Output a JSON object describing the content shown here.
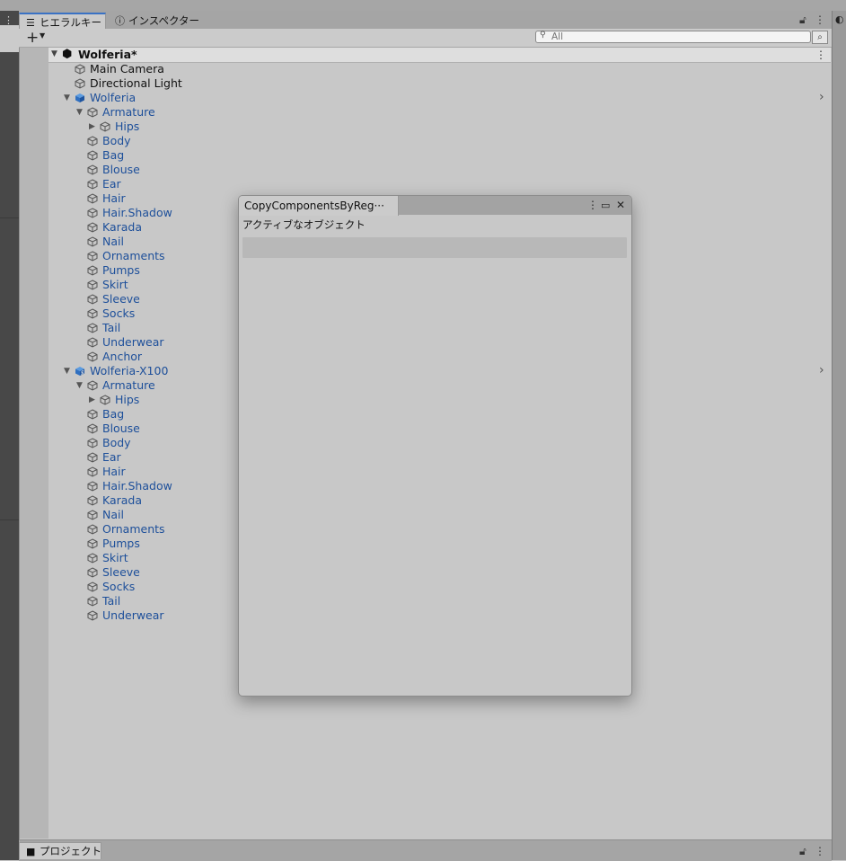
{
  "hierarchy_tab": {
    "label": "ヒエラルキー",
    "icon": "list-icon"
  },
  "inspector_tab": {
    "label": "インスペクター",
    "icon": "info-icon"
  },
  "toolbar": {
    "add_label": "+",
    "search_placeholder": "All"
  },
  "scene": {
    "name": "Wolferia*"
  },
  "tree": [
    {
      "label": "Main Camera",
      "depth": 1,
      "color": "black",
      "expand": "none"
    },
    {
      "label": "Directional Light",
      "depth": 1,
      "color": "black",
      "expand": "none"
    },
    {
      "label": "Wolferia",
      "depth": 1,
      "color": "blue",
      "expand": "open",
      "prefab": true
    },
    {
      "label": "Armature",
      "depth": 2,
      "color": "blue",
      "expand": "open"
    },
    {
      "label": "Hips",
      "depth": 3,
      "color": "blue",
      "expand": "closed"
    },
    {
      "label": "Body",
      "depth": 2,
      "color": "blue",
      "expand": "none"
    },
    {
      "label": "Bag",
      "depth": 2,
      "color": "blue",
      "expand": "none"
    },
    {
      "label": "Blouse",
      "depth": 2,
      "color": "blue",
      "expand": "none"
    },
    {
      "label": "Ear",
      "depth": 2,
      "color": "blue",
      "expand": "none"
    },
    {
      "label": "Hair",
      "depth": 2,
      "color": "blue",
      "expand": "none"
    },
    {
      "label": "Hair.Shadow",
      "depth": 2,
      "color": "blue",
      "expand": "none"
    },
    {
      "label": "Karada",
      "depth": 2,
      "color": "blue",
      "expand": "none"
    },
    {
      "label": "Nail",
      "depth": 2,
      "color": "blue",
      "expand": "none"
    },
    {
      "label": "Ornaments",
      "depth": 2,
      "color": "blue",
      "expand": "none"
    },
    {
      "label": "Pumps",
      "depth": 2,
      "color": "blue",
      "expand": "none"
    },
    {
      "label": "Skirt",
      "depth": 2,
      "color": "blue",
      "expand": "none"
    },
    {
      "label": "Sleeve",
      "depth": 2,
      "color": "blue",
      "expand": "none"
    },
    {
      "label": "Socks",
      "depth": 2,
      "color": "blue",
      "expand": "none"
    },
    {
      "label": "Tail",
      "depth": 2,
      "color": "blue",
      "expand": "none"
    },
    {
      "label": "Underwear",
      "depth": 2,
      "color": "blue",
      "expand": "none"
    },
    {
      "label": "Anchor",
      "depth": 2,
      "color": "blue",
      "expand": "none"
    },
    {
      "label": "Wolferia-X100",
      "depth": 1,
      "color": "blue",
      "expand": "open",
      "prefab": true,
      "variant": true
    },
    {
      "label": "Armature",
      "depth": 2,
      "color": "blue",
      "expand": "open"
    },
    {
      "label": "Hips",
      "depth": 3,
      "color": "blue",
      "expand": "closed"
    },
    {
      "label": "Bag",
      "depth": 2,
      "color": "blue",
      "expand": "none"
    },
    {
      "label": "Blouse",
      "depth": 2,
      "color": "blue",
      "expand": "none"
    },
    {
      "label": "Body",
      "depth": 2,
      "color": "blue",
      "expand": "none"
    },
    {
      "label": "Ear",
      "depth": 2,
      "color": "blue",
      "expand": "none"
    },
    {
      "label": "Hair",
      "depth": 2,
      "color": "blue",
      "expand": "none"
    },
    {
      "label": "Hair.Shadow",
      "depth": 2,
      "color": "blue",
      "expand": "none"
    },
    {
      "label": "Karada",
      "depth": 2,
      "color": "blue",
      "expand": "none"
    },
    {
      "label": "Nail",
      "depth": 2,
      "color": "blue",
      "expand": "none"
    },
    {
      "label": "Ornaments",
      "depth": 2,
      "color": "blue",
      "expand": "none"
    },
    {
      "label": "Pumps",
      "depth": 2,
      "color": "blue",
      "expand": "none"
    },
    {
      "label": "Skirt",
      "depth": 2,
      "color": "blue",
      "expand": "none"
    },
    {
      "label": "Sleeve",
      "depth": 2,
      "color": "blue",
      "expand": "none"
    },
    {
      "label": "Socks",
      "depth": 2,
      "color": "blue",
      "expand": "none"
    },
    {
      "label": "Tail",
      "depth": 2,
      "color": "blue",
      "expand": "none"
    },
    {
      "label": "Underwear",
      "depth": 2,
      "color": "blue",
      "expand": "none"
    }
  ],
  "floating_window": {
    "tab_title": "CopyComponentsByReg···",
    "active_object_label": "アクティブなオブジェクト",
    "active_object_value": ""
  },
  "project_tab": {
    "label": "プロジェクト",
    "icon": "folder-icon"
  },
  "colors": {
    "prefab_blue": "#1d4f9a",
    "tab_accent": "#3a72c4"
  }
}
